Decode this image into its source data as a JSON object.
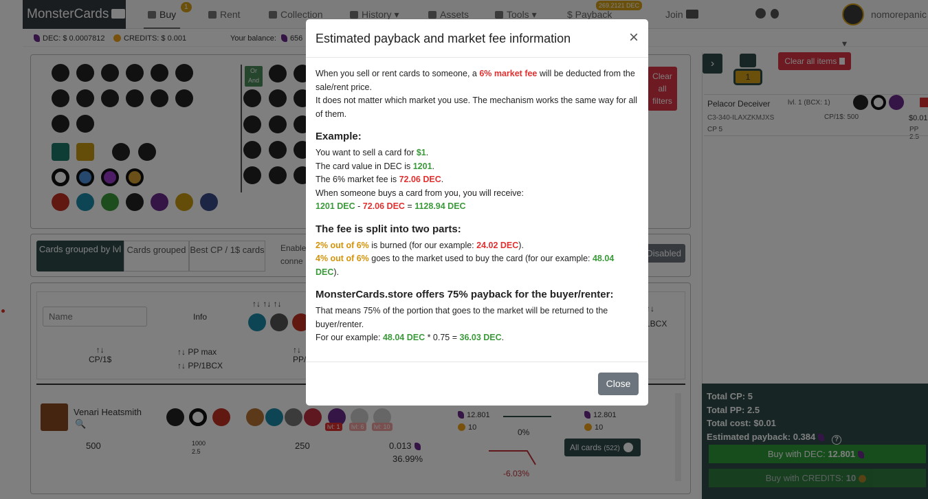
{
  "nav": {
    "brand": "MonsterCards",
    "buy": "Buy",
    "buy_badge": "1",
    "rent": "Rent",
    "collection": "Collection",
    "history": "History",
    "assets": "Assets",
    "tools": "Tools",
    "payback": "$ Payback",
    "payback_badge": "269.2121 DEC",
    "join": "Join",
    "username": "nomorepanic"
  },
  "balance": {
    "dec_label": "DEC: $",
    "dec_value": "0.0007812",
    "credits_label": "CREDITS: $",
    "credits_value": "0.001",
    "your_balance": "Your balance:",
    "your_balance_value": "656"
  },
  "filters": {
    "or_and": "Or And",
    "clear_all_filters": "Clear all filters",
    "group_lvl": "Cards grouped by lvl",
    "group": "Cards grouped",
    "best_cp": "Best CP / 1$ cards",
    "enable": "Enable",
    "connect": "conne",
    "disabled": "Disabled"
  },
  "table": {
    "name_placeholder": "Name",
    "info": "Info",
    "cp1": "CP/1$",
    "pp_max": "PP max",
    "pp_1bcx": "PP/1BCX",
    "pp_trunc": "PP/",
    "bcx": "1BCX",
    "card_name": "Venari Heatsmith",
    "cp": "500",
    "pp_a": "1000",
    "pp_b": "2.5",
    "v250": "250",
    "price": "0.013",
    "pct": "36.99%",
    "lv1": "lvl: 1",
    "lv6": "lvl: 6",
    "lv10": "lvl: 10",
    "dec1": "12.801",
    "cr1": "10",
    "dec2": "12.801",
    "cr2": "10",
    "zero_pct": "0%",
    "neg_pct": "-6.03%",
    "all_cards": "All cards",
    "all_cards_count": "(522)"
  },
  "cart": {
    "count": "1",
    "clear_all": "Clear all items",
    "card_name": "Pelacor Deceiver",
    "lvl": "lvl. 1 (BCX: 1)",
    "card_id": "C3-340-ILAXZKMJXS",
    "cp1": "CP/1$: 500",
    "cp": "CP 5",
    "price": "$0.01",
    "pp": "PP 2.5",
    "total_cp": "Total CP: 5",
    "total_pp": "Total PP: 2.5",
    "total_cost": "Total cost: $0.01",
    "est_payback": "Estimated payback: 0.384",
    "buy_dec_label": "Buy with DEC:",
    "buy_dec_value": "12.801",
    "buy_credits_label": "Buy with CREDITS:",
    "buy_credits_value": "10"
  },
  "modal": {
    "title": "Estimated payback and market fee information",
    "p1a": "When you sell or rent cards to someone, a ",
    "p1b": "6% market fee",
    "p1c": " will be deducted from the sale/rent price.",
    "p2": "It does not matter which market you use. The mechanism works the same way for all of them.",
    "h_example": "Example:",
    "e1a": "You want to sell a card for ",
    "e1b": "$1",
    "e2a": "The card value in DEC is ",
    "e2b": "1201",
    "e3a": "The 6% market fee is ",
    "e3b": "72.06 DEC",
    "e4": "When someone buys a card from you, you will receive:",
    "e5a": "1201 DEC",
    "e5b": "72.06 DEC",
    "e5c": "1128.94 DEC",
    "h_split": "The fee is split into two parts:",
    "s1a": "2% out of 6%",
    "s1b": " is burned (for our example: ",
    "s1c": "24.02 DEC",
    "s2a": "4% out of 6%",
    "s2b": " goes to the market used to buy the card (for our example: ",
    "s2c": "48.04 DEC",
    "h_payback": "MonsterCards.store offers 75% payback for the buyer/renter:",
    "m1": "That means 75% of the portion that goes to the market will be returned to the buyer/renter.",
    "m2a": "For our example: ",
    "m2b": "48.04 DEC",
    "m2c": " * 0.75 = ",
    "m2d": "36.03 DEC",
    "close_button": "Close"
  },
  "colors": {
    "red": "#e03030",
    "green": "#3a9a3a",
    "orange": "#d4930a",
    "dark_teal": "#2f4b4b",
    "buy_green": "#2e9a3a"
  }
}
